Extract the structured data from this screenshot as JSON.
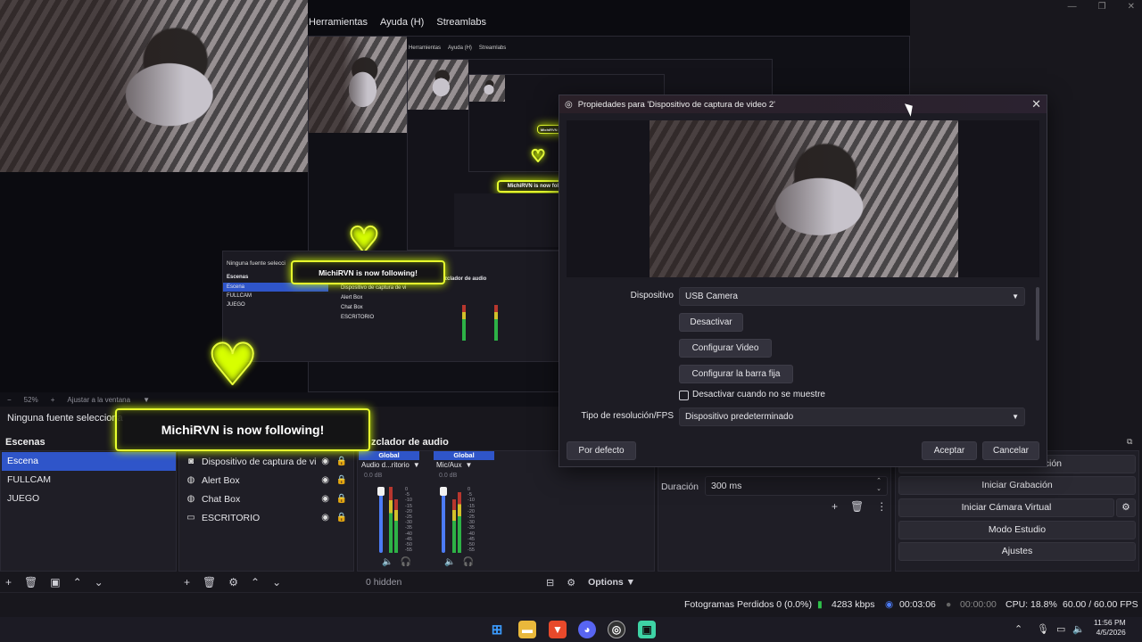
{
  "menu": [
    "Herramientas",
    "Ayuda (H)",
    "Streamlabs"
  ],
  "nested_menu": [
    "Herramientas",
    "Ayuda (H)",
    "Streamlabs"
  ],
  "window_controls": [
    "minimize-icon",
    "maximize-icon",
    "close-icon"
  ],
  "zoom": {
    "value": "52%",
    "fit_label": "Ajustar a la ventana"
  },
  "nested_zoom": {
    "value": "52%",
    "fit_label": "Ajustar a la ventana"
  },
  "alerts": {
    "main_text": "MichiRVN is now following!",
    "nested_text": "MichiRVN is now following!",
    "small_text": "MichiRVN is now following!"
  },
  "no_source_label": "Ninguna fuente selecciona",
  "nested_no_source_label": "Ninguna fuente selecci",
  "scenes": {
    "title": "Escenas",
    "items": [
      "Escena",
      "FULLCAM",
      "JUEGO"
    ],
    "selected": "Escena"
  },
  "sources": {
    "items": [
      {
        "name": "Dispositivo de captura de vi",
        "icon": "camera-icon"
      },
      {
        "name": "Alert Box",
        "icon": "globe-icon"
      },
      {
        "name": "Chat Box",
        "icon": "globe-icon"
      },
      {
        "name": "ESCRITORIO",
        "icon": "monitor-icon"
      }
    ],
    "nested_items": [
      "Dispositivo de captura de vi",
      "Alert Box",
      "Chat Box",
      "ESCRITORIO"
    ]
  },
  "mixer": {
    "title": "zclador de audio",
    "nested_title": "zclador de audio",
    "hidden_label": "0 hidden",
    "options_label": "Options",
    "channels": [
      {
        "global": "Global",
        "name": "Audio d...ritorio",
        "db": "0.0 dB"
      },
      {
        "global": "Global",
        "name": "Mic/Aux",
        "db": "0.0 dB"
      }
    ],
    "ticks": [
      "0",
      "-5",
      "-10",
      "-15",
      "-20",
      "-25",
      "-30",
      "-35",
      "-40",
      "-45",
      "-50",
      "-55",
      "-60"
    ]
  },
  "transitions": {
    "duration_label": "Duración",
    "duration_value": "300 ms"
  },
  "controls": {
    "partial_label": "abación",
    "buttons": [
      "Iniciar Grabación",
      "Iniciar Cámara Virtual",
      "Modo Estudio",
      "Ajustes"
    ]
  },
  "status": {
    "dropped": "Fotogramas Perdidos 0 (0.0%)",
    "bitrate": "4283 kbps",
    "live_time": "00:03:06",
    "rec_time": "00:00:00",
    "cpu": "CPU: 18.8%",
    "fps": "60.00 / 60.00 FPS"
  },
  "taskbar": {
    "apps": [
      "windows-start-icon",
      "file-explorer-icon",
      "brave-icon",
      "discord-icon",
      "obs-icon",
      "streamlabs-icon"
    ],
    "time": "11:56 PM",
    "date": "4/5/2026"
  },
  "dialog": {
    "title": "Propiedades para 'Dispositivo de captura de video 2'",
    "nested_title": "Propiedades para 'Dispositivo de captura de video 2'",
    "device_label": "Dispositivo",
    "device_value": "USB Camera",
    "btn_deactivate": "Desactivar",
    "btn_config_video": "Configurar Video",
    "btn_config_crossbar": "Configurar la barra fija",
    "checkbox_label": "Desactivar cuando no se muestre",
    "checkbox_checked": false,
    "res_label": "Tipo de resolución/FPS",
    "res_value": "Dispositivo predeterminado",
    "btn_defaults": "Por defecto",
    "btn_accept": "Aceptar",
    "btn_cancel": "Cancelar"
  },
  "colors": {
    "alert_border": "#e7ff2e",
    "selection_blue": "#2f55c9",
    "panel_bg": "#1f1e26"
  }
}
